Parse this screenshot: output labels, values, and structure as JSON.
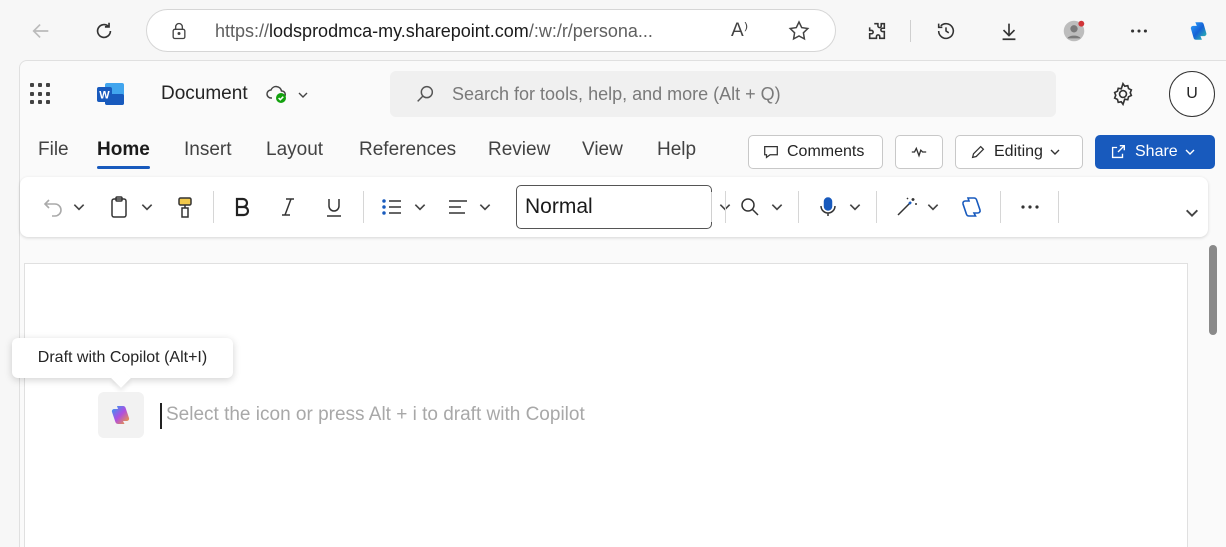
{
  "browser": {
    "url_prefix": "https://",
    "url_host": "lodsprodmca-my.sharepoint.com",
    "url_rest": "/:w:/r/persona...",
    "read_aloud_label": "A⁾"
  },
  "app": {
    "doc_title": "Document",
    "search_placeholder": "Search for tools, help, and more (Alt + Q)",
    "avatar_initial": "U",
    "accent_color": "#185abd"
  },
  "ribbon": {
    "tabs": [
      {
        "label": "File"
      },
      {
        "label": "Home"
      },
      {
        "label": "Insert"
      },
      {
        "label": "Layout"
      },
      {
        "label": "References"
      },
      {
        "label": "Review"
      },
      {
        "label": "View"
      },
      {
        "label": "Help"
      }
    ],
    "comments_label": "Comments",
    "editing_label": "Editing",
    "share_label": "Share"
  },
  "toolbar": {
    "style_value": "Normal"
  },
  "canvas": {
    "tooltip": "Draft with Copilot (Alt+I)",
    "draft_hint": "Select the icon or press Alt + i to draft with Copilot"
  }
}
